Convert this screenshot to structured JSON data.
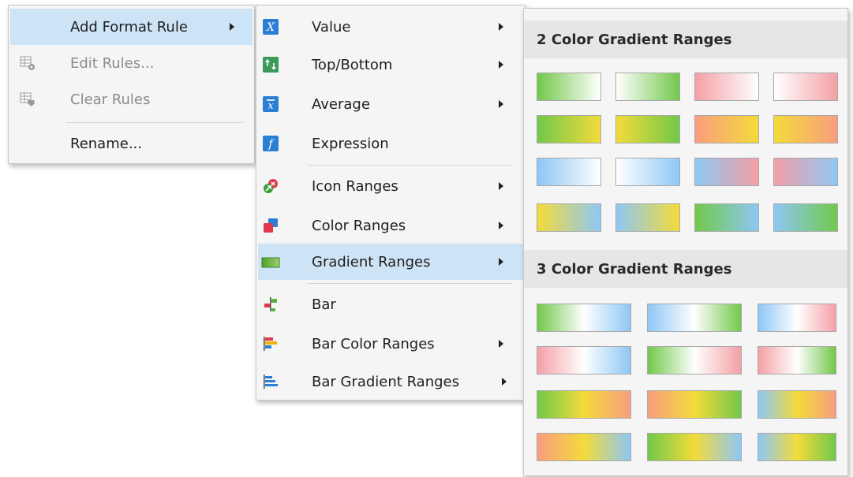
{
  "context_menu": {
    "add_format_rule": "Add Format Rule",
    "edit_rules": "Edit Rules...",
    "clear_rules": "Clear Rules",
    "rename": "Rename..."
  },
  "rule_menu": {
    "value": "Value",
    "top_bottom": "Top/Bottom",
    "average": "Average",
    "expression": "Expression",
    "icon_ranges": "Icon Ranges",
    "color_ranges": "Color Ranges",
    "gradient_ranges": "Gradient Ranges",
    "bar": "Bar",
    "bar_color_ranges": "Bar Color Ranges",
    "bar_gradient_ranges": "Bar Gradient Ranges",
    "icon_glyphs": {
      "value": "X",
      "average": "x",
      "expression": "f"
    }
  },
  "gallery": {
    "two_color_title": "2 Color Gradient Ranges",
    "three_color_title": "3 Color Gradient Ranges"
  },
  "colors": {
    "menu_bg": "#f5f5f5",
    "highlight": "#cde3f6",
    "header_bg": "#e6e6e6",
    "green": "#72c84a",
    "red": "#f4a0a6",
    "yellow": "#f3db3a",
    "blue": "#8ec7f5",
    "orange": "#f99d7f"
  }
}
